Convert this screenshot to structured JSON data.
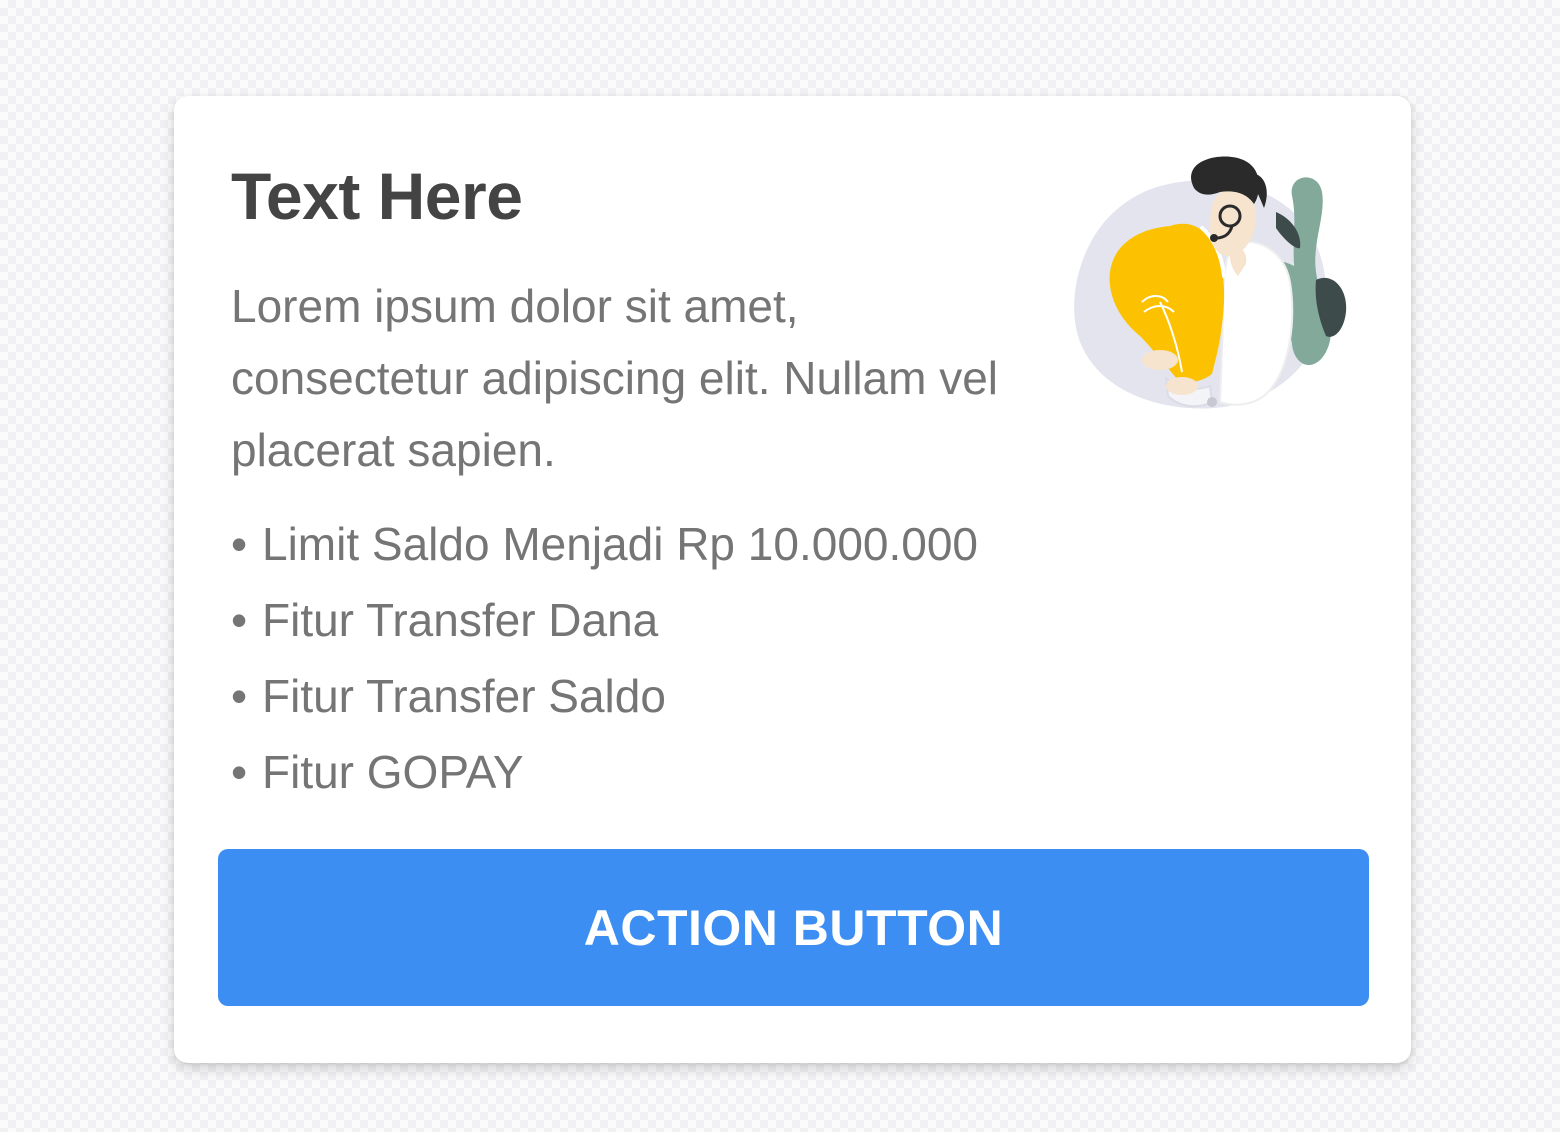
{
  "card": {
    "title": "Text Here",
    "description": "Lorem ipsum dolor sit amet, consectetur adipiscing elit. Nullam vel placerat sapien.",
    "bullet": "•",
    "features": [
      {
        "label": "Limit Saldo Menjadi Rp 10.000.000"
      },
      {
        "label": "Fitur Transfer Dana"
      },
      {
        "label": "Fitur Transfer Saldo"
      },
      {
        "label": "Fitur GOPAY"
      }
    ],
    "illustration": {
      "icon": "person-holding-lightbulb-illustration",
      "colors": {
        "blob": "#e4e4ee",
        "bulb": "#fcc201",
        "plant": "#82a99a",
        "hair": "#2a2a2a"
      }
    },
    "action_button": {
      "label": "ACTION BUTTON",
      "color": "#3d8ef2"
    }
  }
}
